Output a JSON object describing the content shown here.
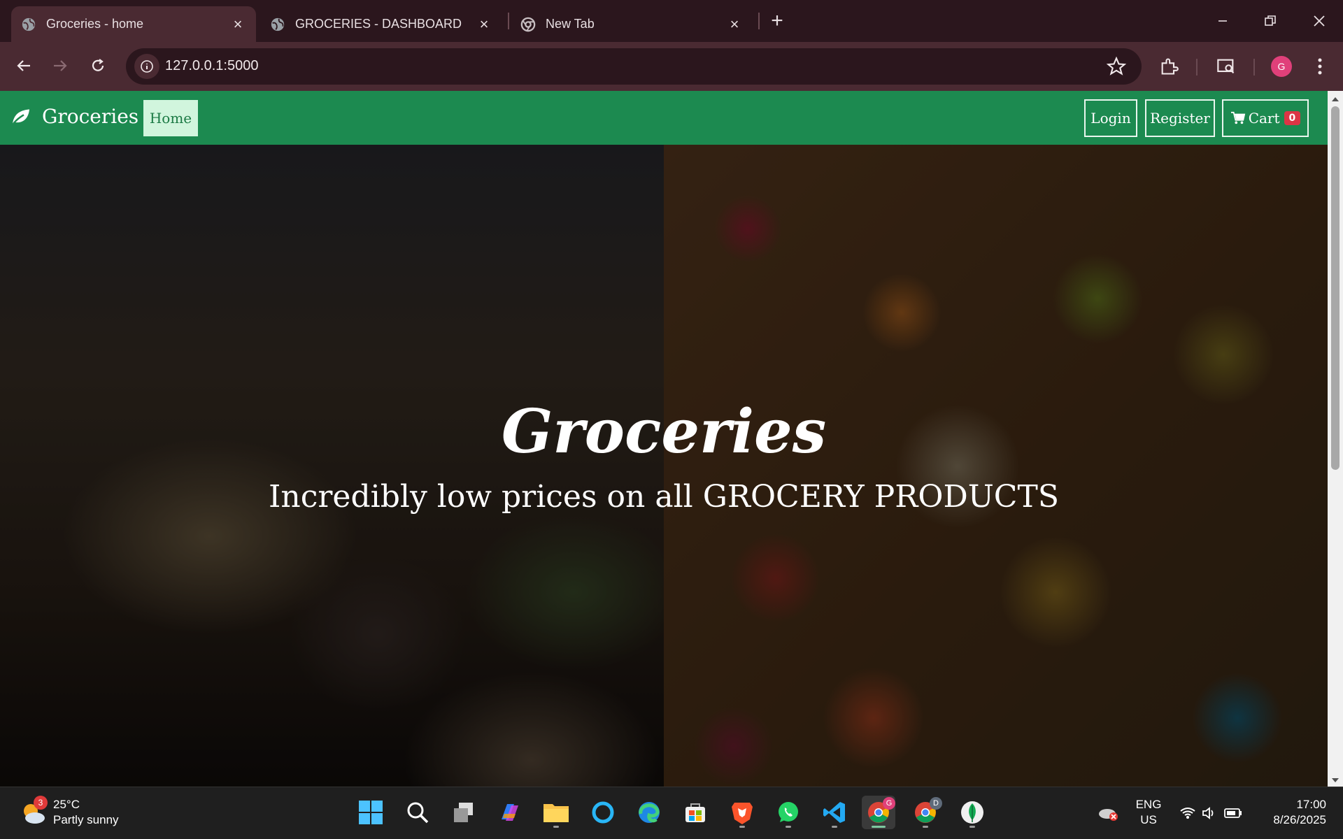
{
  "browser": {
    "tabs": [
      {
        "title": "Groceries - home",
        "active": true
      },
      {
        "title": "GROCERIES - DASHBOARD",
        "active": false
      },
      {
        "title": "New Tab",
        "active": false
      }
    ],
    "url": "127.0.0.1:5000",
    "profile_initial": "G"
  },
  "navbar": {
    "brand": "Groceries",
    "home_label": "Home",
    "login_label": "Login",
    "register_label": "Register",
    "cart_label": "Cart",
    "cart_count": "0"
  },
  "hero": {
    "title": "Groceries",
    "subtitle": "Incredibly low prices on all GROCERY PRODUCTS"
  },
  "taskbar": {
    "weather_temp": "25°C",
    "weather_desc": "Partly sunny",
    "weather_badge": "3",
    "lang_top": "ENG",
    "lang_bottom": "US",
    "time": "17:00",
    "date": "8/26/2025",
    "chrome_badge_1": "G",
    "chrome_badge_2": "D"
  },
  "colors": {
    "navbar_bg": "#1c8a50",
    "home_active_bg": "#d1f5dd",
    "cart_badge": "#dc3545",
    "browser_frame": "#4a2a32"
  }
}
